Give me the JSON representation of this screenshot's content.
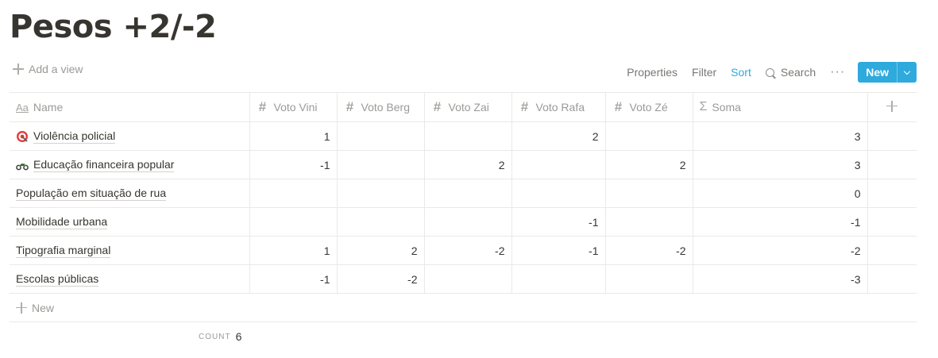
{
  "page": {
    "title": "Pesos +2/-2"
  },
  "toolbar": {
    "add_view": "Add a view",
    "properties": "Properties",
    "filter": "Filter",
    "sort": "Sort",
    "search": "Search",
    "more": "···",
    "new": "New",
    "accent_color": "#2eaadc"
  },
  "table": {
    "columns": [
      {
        "label": "Name",
        "icon": "text-property-icon"
      },
      {
        "label": "Voto Vini",
        "icon": "number-icon"
      },
      {
        "label": "Voto Berg",
        "icon": "number-icon"
      },
      {
        "label": "Voto Zai",
        "icon": "number-icon"
      },
      {
        "label": "Voto Rafa",
        "icon": "number-icon"
      },
      {
        "label": "Voto Zé",
        "icon": "number-icon"
      },
      {
        "label": "Soma",
        "icon": "sigma-icon"
      }
    ],
    "rows": [
      {
        "name": "Violência policial",
        "icon": "target-emoji-icon",
        "vini": "1",
        "berg": "",
        "zai": "",
        "rafa": "2",
        "ze": "",
        "soma": "3"
      },
      {
        "name": "Educação financeira popular",
        "icon": "motorcycle-emoji-icon",
        "vini": "-1",
        "berg": "",
        "zai": "2",
        "rafa": "",
        "ze": "2",
        "soma": "3"
      },
      {
        "name": "População em situação de rua",
        "icon": "",
        "vini": "",
        "berg": "",
        "zai": "",
        "rafa": "",
        "ze": "",
        "soma": "0"
      },
      {
        "name": "Mobilidade urbana",
        "icon": "",
        "vini": "",
        "berg": "",
        "zai": "",
        "rafa": "-1",
        "ze": "",
        "soma": "-1"
      },
      {
        "name": "Tipografia marginal",
        "icon": "",
        "vini": "1",
        "berg": "2",
        "zai": "-2",
        "rafa": "-1",
        "ze": "-2",
        "soma": "-2"
      },
      {
        "name": "Escolas públicas",
        "icon": "",
        "vini": "-1",
        "berg": "-2",
        "zai": "",
        "rafa": "",
        "ze": "",
        "soma": "-3"
      }
    ],
    "new_row_label": "New"
  },
  "footer": {
    "count_label": "COUNT",
    "count_value": "6"
  }
}
